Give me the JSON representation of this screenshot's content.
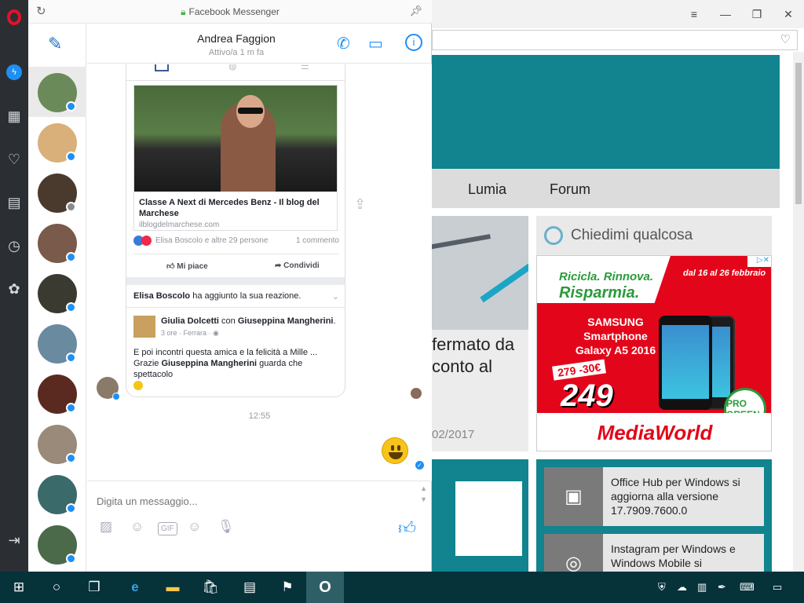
{
  "messenger": {
    "window_title": "Facebook Messenger",
    "contact": {
      "name": "Andrea Faggion",
      "status": "Attivo/a 1 m fa"
    },
    "link": {
      "title": "Classe A Next di Mercedes Benz - Il blog del Marchese",
      "domain": "ilblogdelmarchese.com",
      "reactions_text": "Elisa Boscolo e altre 29 persone",
      "comments_text": "1 commento",
      "like_label": "Mi piace",
      "share_label": "Condividi"
    },
    "reaction_note": {
      "name": "Elisa Boscolo",
      "text": "ha aggiunto la sua reazione."
    },
    "post": {
      "author": "Giulia Dolcetti",
      "with_text": "con",
      "tagged": "Giuseppina Mangherini",
      "meta": "3 ore · Ferrara · ",
      "text1": "E poi incontri questa amica e la felicità a Mille ...",
      "text2_prefix": "Grazie",
      "text2_name": "Giuseppina Mangherini",
      "text2_suffix": "guarda che spettacolo"
    },
    "timestamp": "12:55",
    "composer_placeholder": "Digita un messaggio...",
    "gif_label": "GIF"
  },
  "browser": {
    "nav": [
      "Lumia",
      "Forum"
    ],
    "article": {
      "text": "fermato da conto al",
      "date": "02/2017"
    },
    "cortana_prompt": "Chiedimi qualcosa",
    "ad": {
      "slogan1": "Ricicla. Rinnova.",
      "slogan2": "Risparmia.",
      "dates": "dal 16 al 26 febbraio",
      "product": "SAMSUNG Smartphone Galaxy A5 2016",
      "old_price": "279 -30€",
      "price": "249",
      "pro": "PRO GREEN",
      "brand": "MediaWorld"
    },
    "news": [
      {
        "text": "Office Hub per Windows si aggiorna alla versione 17.7909.7600.0"
      },
      {
        "text": "Instagram per Windows e Windows Mobile si"
      }
    ]
  },
  "colors": {
    "accent": "#1e8ff5",
    "teal": "#11848f",
    "opera_red": "#e1122a",
    "taskbar": "#06323a"
  }
}
